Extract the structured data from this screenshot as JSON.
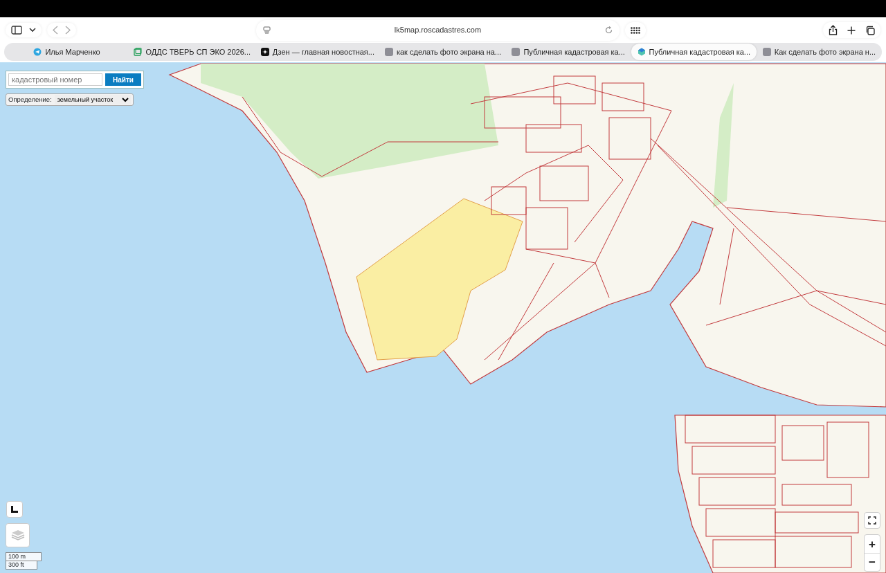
{
  "toolbar": {
    "address": "lk5map.roscadastres.com"
  },
  "tabs": [
    {
      "title": "Илья Марченко",
      "selected": false,
      "kind": "telegram"
    },
    {
      "title": "ОДДС ТВЕРЬ СП ЭКО 2026...",
      "selected": false,
      "kind": "sheets"
    },
    {
      "title": "Дзен — главная новостная...",
      "selected": false,
      "kind": "star"
    },
    {
      "title": "как сделать фото экрана на...",
      "selected": false,
      "kind": "grey"
    },
    {
      "title": "Публичная кадастровая ка...",
      "selected": false,
      "kind": "grey"
    },
    {
      "title": "Публичная кадастровая ка...",
      "selected": true,
      "kind": "cube"
    },
    {
      "title": "Как сделать фото экрана н...",
      "selected": false,
      "kind": "grey"
    }
  ],
  "map": {
    "search": {
      "placeholder": "кадастровый номер"
    },
    "search_button": "Найти",
    "definition": {
      "label": "Определение:",
      "value": "земельный участок"
    },
    "scale": [
      "100 m",
      "300 ft"
    ],
    "zoom_in": "+",
    "zoom_out": "−"
  }
}
